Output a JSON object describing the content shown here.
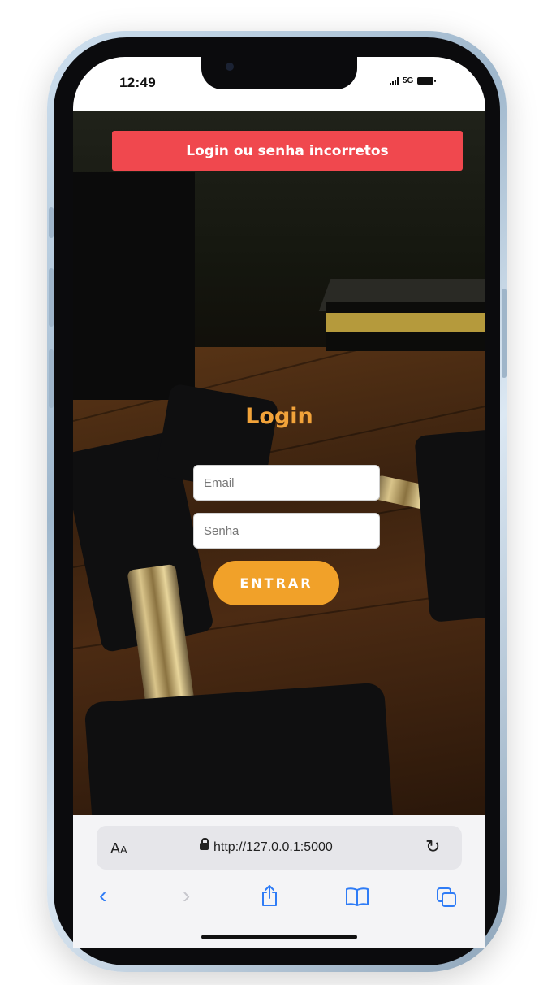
{
  "status_bar": {
    "time": "12:49",
    "network": "5G"
  },
  "alert": {
    "message": "Login ou senha incorretos",
    "color": "#f0484e"
  },
  "login": {
    "title": "Login",
    "email_placeholder": "Email",
    "password_placeholder": "Senha",
    "submit_label": "ENTRAR",
    "accent_color": "#f1a129"
  },
  "browser": {
    "text_size_label_big": "A",
    "text_size_label_small": "A",
    "url": "http://127.0.0.1:5000",
    "icons": [
      "lock-icon",
      "reload-icon",
      "back-icon",
      "forward-icon",
      "share-icon",
      "bookmarks-icon",
      "tabs-icon"
    ]
  }
}
